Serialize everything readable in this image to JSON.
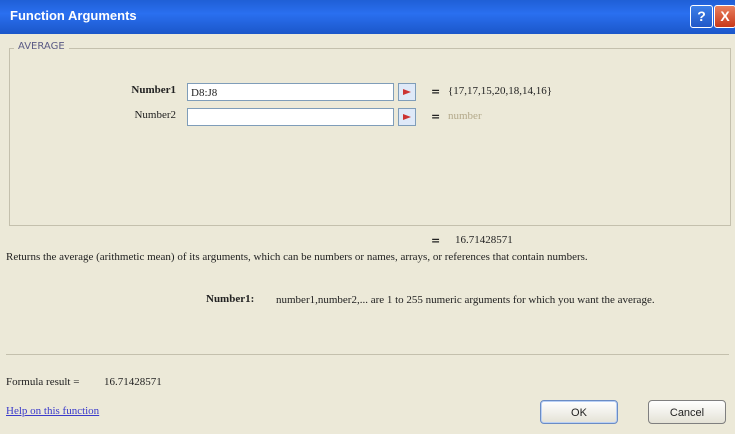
{
  "window": {
    "title": "Function Arguments"
  },
  "titlebar": {
    "help_label": "?",
    "close_label": "X"
  },
  "function_group": {
    "name": "AVERAGE"
  },
  "args": [
    {
      "label": "Number1",
      "value": "D8:J8",
      "equals": "=",
      "result": "{17,17,15,20,18,14,16}"
    },
    {
      "label": "Number2",
      "value": "",
      "equals": "=",
      "result": "number"
    }
  ],
  "summary": {
    "equals": "=",
    "value": "16.71428571",
    "description": "Returns the average (arithmetic mean) of its arguments, which can be numbers or names, arrays, or references that contain numbers."
  },
  "arg_help": {
    "label": "Number1:",
    "text": "number1,number2,... are 1 to 255 numeric arguments for which you want the average."
  },
  "formula_result": {
    "label": "Formula result =",
    "value": "16.71428571"
  },
  "footer": {
    "help_link": "Help on this function",
    "ok_label": "OK",
    "cancel_label": "Cancel"
  }
}
